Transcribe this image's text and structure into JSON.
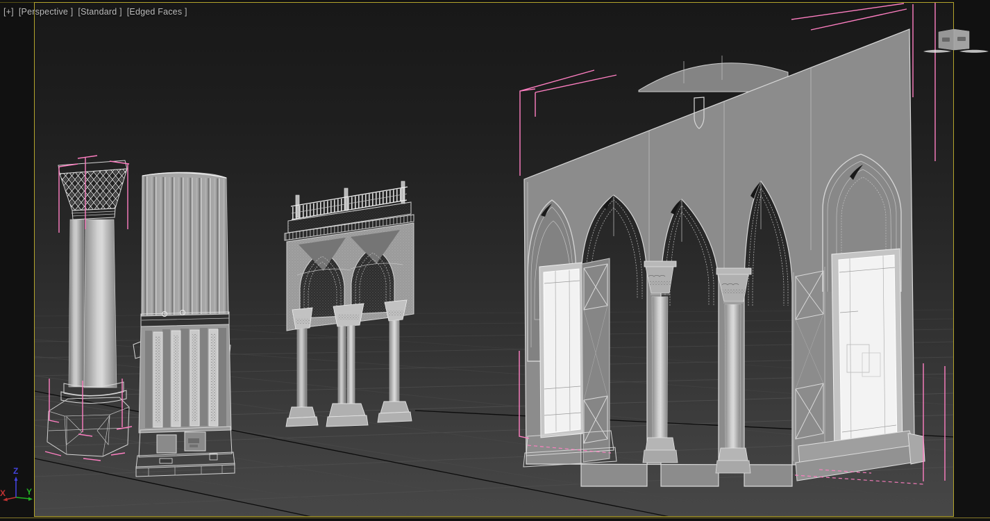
{
  "viewport": {
    "label": {
      "general": "[+]",
      "pov": "[Perspective ]",
      "render_style": "[Standard ]",
      "shading": "[Edged Faces ]"
    },
    "border_color": "#b3a42c",
    "background_top": "#181818",
    "background_bottom": "#474747",
    "label_color": "#bcbcbc"
  },
  "axis_gizmo": {
    "x": "X",
    "y": "Y",
    "z": "Z",
    "x_color": "#c03232",
    "y_color": "#23b223",
    "z_color": "#4343dc"
  },
  "scene": {
    "objects": [
      {
        "name": "twin-corinthian-column",
        "selected": true
      },
      {
        "name": "fluted-panel-column",
        "selected": false
      },
      {
        "name": "gothic-arch-shrine",
        "selected": false
      },
      {
        "name": "pointed-arch-arcade-wall",
        "selected": true
      },
      {
        "name": "distant-cube",
        "selected": false
      }
    ],
    "selection_color": "#ff7fc2",
    "grid_minor_color": "#4c4c4c",
    "grid_major_color": "#0b0b0b",
    "model_edge_color": "#d6d6d6",
    "model_fill_color": "#8c8c8c",
    "window_glass_color": "#f3f3f3"
  }
}
